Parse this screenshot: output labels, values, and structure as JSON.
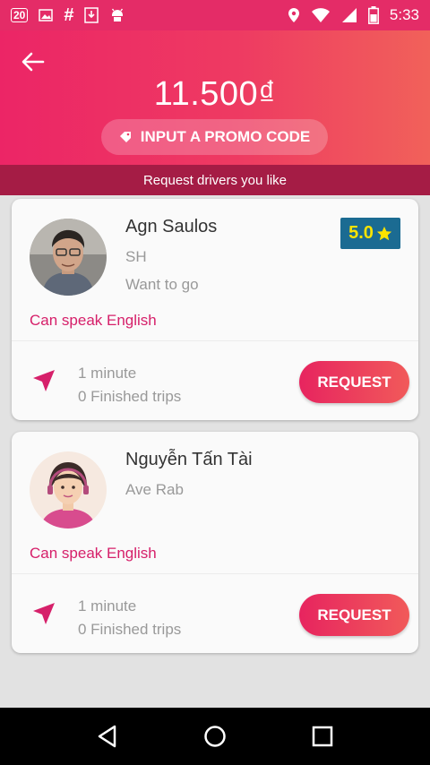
{
  "status_bar": {
    "left_badge": "20",
    "time": "5:33"
  },
  "header": {
    "amount": "11.500₫",
    "promo_label": "INPUT A PROMO CODE"
  },
  "banner": {
    "text": "Request drivers you like"
  },
  "drivers": [
    {
      "name": "Agn Saulos",
      "vehicle": "SH",
      "note": "Want to go",
      "rating": "5.0",
      "language": "Can speak English",
      "eta": "1 minute",
      "trips": "0 Finished trips",
      "request_label": "REQUEST"
    },
    {
      "name": "Nguyễn Tấn Tài",
      "vehicle": "Ave Rab",
      "language": "Can speak English",
      "eta": "1 minute",
      "trips": "0 Finished trips",
      "request_label": "REQUEST"
    }
  ],
  "colors": {
    "accent": "#e42c67",
    "banner": "#a51c45",
    "rating_bg": "#1b6b92",
    "rating_star": "#fbe300"
  },
  "icons": [
    "back-arrow-icon",
    "tag-icon",
    "star-icon",
    "navigation-icon",
    "nav-back-icon",
    "nav-home-icon",
    "nav-recents-icon"
  ]
}
